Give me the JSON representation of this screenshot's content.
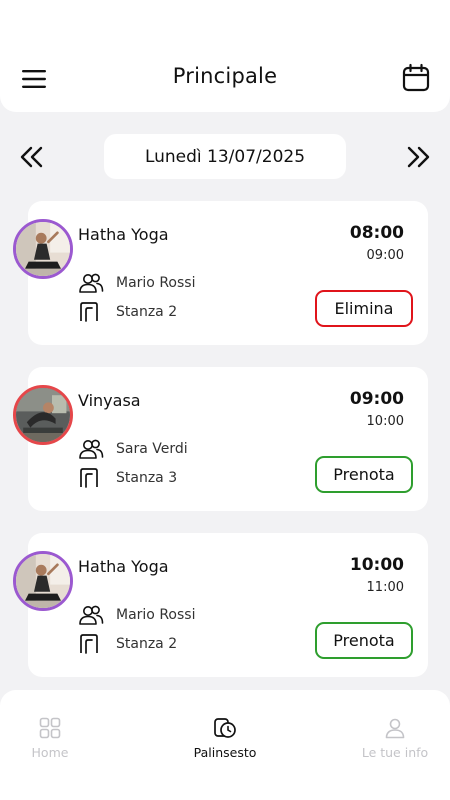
{
  "header": {
    "title": "Principale",
    "menu_icon": "hamburger-menu-icon",
    "calendar_icon": "calendar-icon"
  },
  "date_nav": {
    "date": "Lunedì 13/07/2025",
    "prev_icon": "double-chevron-left-icon",
    "next_icon": "double-chevron-right-icon"
  },
  "lessons": [
    {
      "name": "Hatha Yoga",
      "start": "08:00",
      "end": "09:00",
      "teacher": "Mario Rossi",
      "room": "Stanza 2",
      "action": "Elimina",
      "action_color": "#e0141b",
      "avatar_border": "#9b59d0"
    },
    {
      "name": "Vinyasa",
      "start": "09:00",
      "end": "10:00",
      "teacher": "Sara Verdi",
      "room": "Stanza 3",
      "action": "Prenota",
      "action_color": "#2e9e2e",
      "avatar_border": "#e5474a"
    },
    {
      "name": "Hatha Yoga",
      "start": "10:00",
      "end": "11:00",
      "teacher": "Mario Rossi",
      "room": "Stanza 2",
      "action": "Prenota",
      "action_color": "#2e9e2e",
      "avatar_border": "#9b59d0"
    }
  ],
  "bottom_nav": {
    "items": [
      {
        "label": "Home",
        "icon": "grid-icon",
        "active": false
      },
      {
        "label": "Palinsesto",
        "icon": "schedule-icon",
        "active": true
      },
      {
        "label": "Le tue info",
        "icon": "user-icon",
        "active": false
      }
    ]
  },
  "colors": {
    "background": "#f2f2f4",
    "card": "#ffffff",
    "delete": "#e0141b",
    "book": "#2e9e2e",
    "inactive_nav": "#c4c4c8"
  }
}
